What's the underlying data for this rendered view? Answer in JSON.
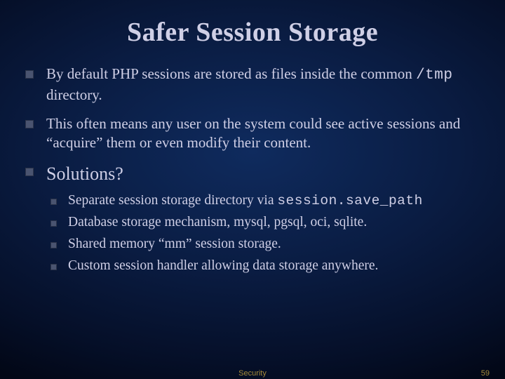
{
  "title": "Safer Session Storage",
  "bullets": [
    {
      "pre": "By default PHP sessions are stored as files inside the common ",
      "code": "/tmp",
      "post": " directory."
    },
    {
      "text": "This often means any user on the system could see active sessions and “acquire” them or even modify their content."
    }
  ],
  "solutions_label": "Solutions?",
  "solutions": [
    {
      "pre": "Separate session storage directory via ",
      "code": "session.save_path",
      "post": ""
    },
    {
      "text": "Database storage mechanism, mysql, pgsql, oci, sqlite."
    },
    {
      "text": "Shared memory “mm” session storage."
    },
    {
      "text": "Custom session handler allowing data storage anywhere."
    }
  ],
  "footer": {
    "center": "Security",
    "page": "59"
  }
}
